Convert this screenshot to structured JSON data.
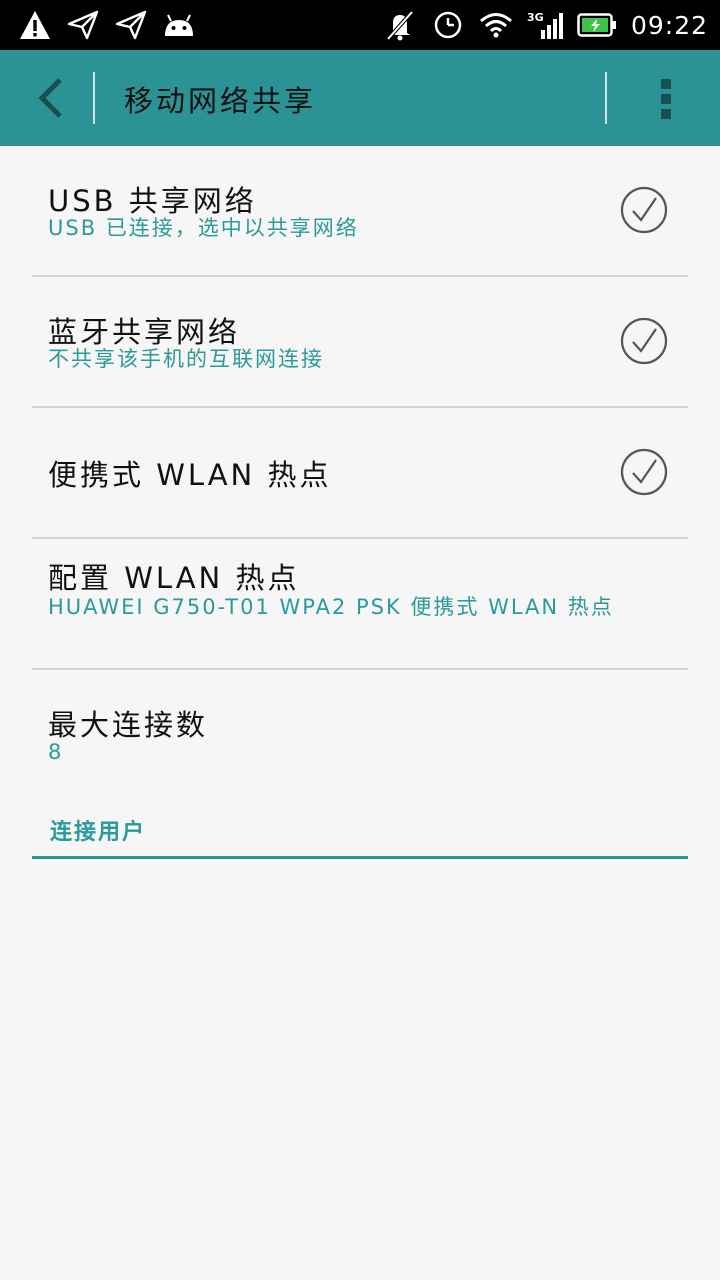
{
  "status_bar": {
    "time": "09:22",
    "network": "3G",
    "icons_left": [
      "warning-icon",
      "send-icon",
      "send-icon",
      "android-icon"
    ],
    "icons_right": [
      "mute-icon",
      "alarm-icon",
      "wifi-icon",
      "signal-icon",
      "battery-icon"
    ]
  },
  "app_bar": {
    "title": "移动网络共享",
    "color": "#2b9295"
  },
  "settings": [
    {
      "title": "USB 共享网络",
      "subtitle": "USB 已连接，选中以共享网络",
      "checked": true
    },
    {
      "title": "蓝牙共享网络",
      "subtitle": "不共享该手机的互联网连接",
      "checked": true
    },
    {
      "title": "便携式 WLAN 热点",
      "subtitle": "",
      "checked": true
    },
    {
      "title": "配置 WLAN 热点",
      "subtitle": "HUAWEI G750-T01 WPA2 PSK 便携式 WLAN 热点"
    },
    {
      "title": "最大连接数",
      "subtitle": "8"
    }
  ],
  "section": {
    "label": "连接用户"
  },
  "colors": {
    "accent": "#2b9295",
    "subtitle": "#2a9a9b",
    "background": "#f6f6f6"
  }
}
